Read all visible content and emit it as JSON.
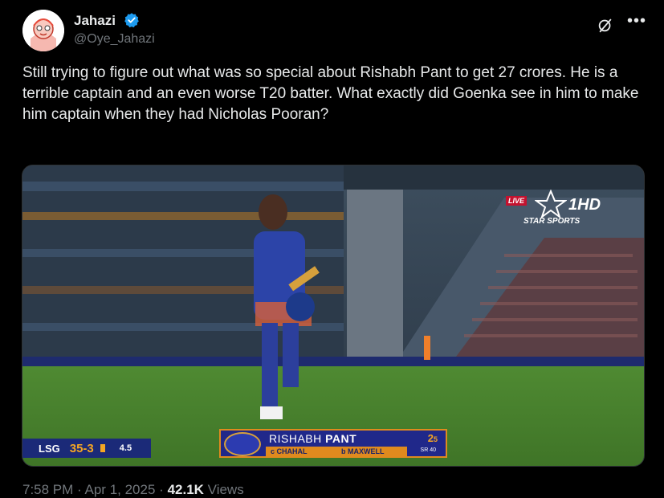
{
  "author": {
    "name": "Jahazi",
    "handle": "@Oye_Jahazi",
    "verified_color": "#1d9bf0"
  },
  "icons": {
    "grok": "grok-icon",
    "more": "more-options-icon",
    "verified": "verified-badge-icon",
    "avatar": "avatar"
  },
  "tweet": {
    "text": "Still trying to figure out what was so special about Rishabh Pant to get 27 crores. He is a terrible captain and an even worse T20 batter. What exactly did Goenka see in him to make him captain when they had Nicholas Pooran?"
  },
  "media": {
    "broadcast": {
      "live": "LIVE",
      "channel_number": "1HD",
      "channel_name": "STAR SPORTS"
    },
    "scorebug": {
      "team": "LSG",
      "score": "35-3",
      "overs": "4.5"
    },
    "batter": {
      "first_name": "RISHABH",
      "last_name": "PANT",
      "caught": "c CHAHAL",
      "bowled": "b MAXWELL",
      "runs": "2",
      "balls": "5",
      "sr": "SR 40"
    }
  },
  "meta": {
    "time": "7:58 PM",
    "separator": "·",
    "date": "Apr 1, 2025",
    "views_count": "42.1K",
    "views_label": "Views"
  },
  "colors": {
    "background": "#000000",
    "text_primary": "#e7e9ea",
    "text_secondary": "#71767b",
    "lsg_blue": "#20288a",
    "lsg_orange": "#e08a1e"
  }
}
